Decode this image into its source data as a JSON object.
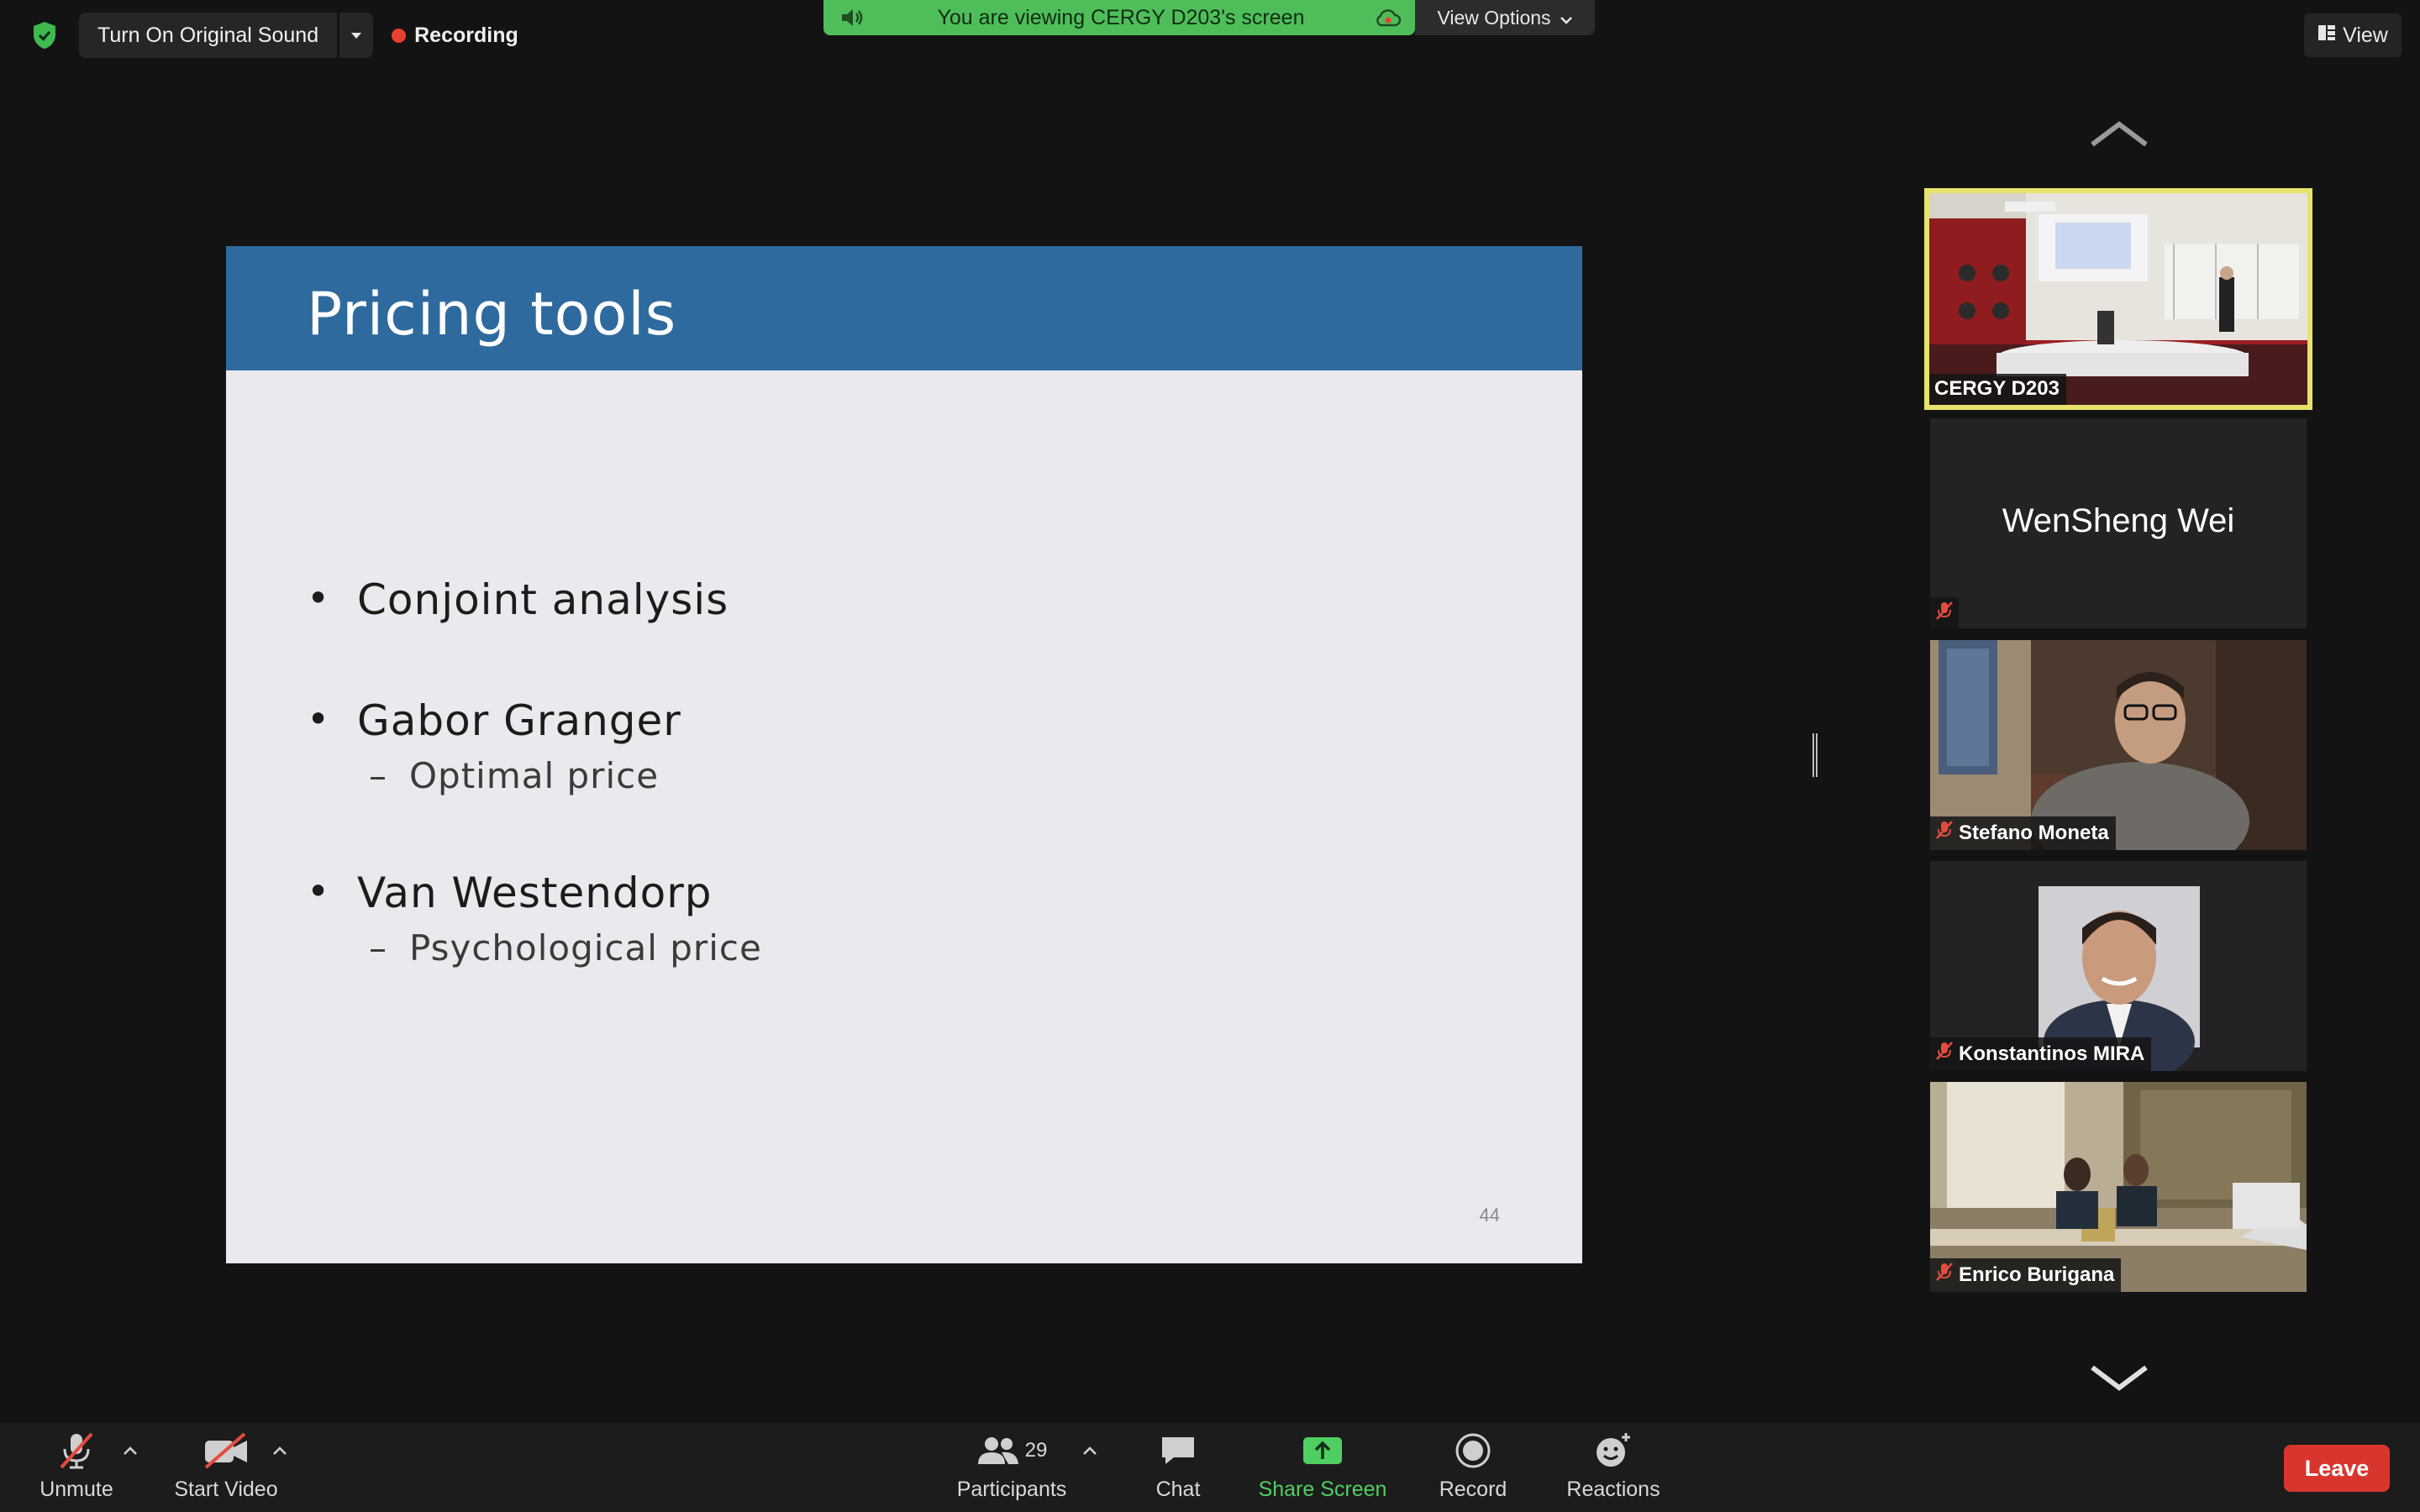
{
  "top_bar": {
    "original_sound_label": "Turn On Original Sound",
    "recording_label": "Recording",
    "viewing_banner": "You are viewing CERGY D203's screen",
    "view_options_label": "View Options",
    "view_label": "View"
  },
  "slide": {
    "title": "Pricing tools",
    "bullets": [
      {
        "text": "Conjoint analysis"
      },
      {
        "text": "Gabor Granger",
        "sub": "Optimal price"
      },
      {
        "text": "Van Westendorp",
        "sub": "Psychological price"
      }
    ],
    "sub_dash": "–",
    "page_number": "44"
  },
  "participants_panel": {
    "tiles": [
      {
        "name": "CERGY D203",
        "active": true
      },
      {
        "name": "WenSheng Wei",
        "video": false
      },
      {
        "name": "Stefano Moneta"
      },
      {
        "name": "Konstantinos MIRA"
      },
      {
        "name": "Enrico Burigana"
      }
    ]
  },
  "toolbar": {
    "unmute_label": "Unmute",
    "start_video_label": "Start Video",
    "participants_label": "Participants",
    "participants_count": "29",
    "chat_label": "Chat",
    "share_screen_label": "Share Screen",
    "record_label": "Record",
    "reactions_label": "Reactions",
    "leave_label": "Leave"
  },
  "colors": {
    "banner_green": "#4fbe5a",
    "slide_header_blue": "#2e6a9e",
    "active_speaker_border": "#e7e36b",
    "leave_red": "#d9352f",
    "share_green": "#4fcf62"
  }
}
